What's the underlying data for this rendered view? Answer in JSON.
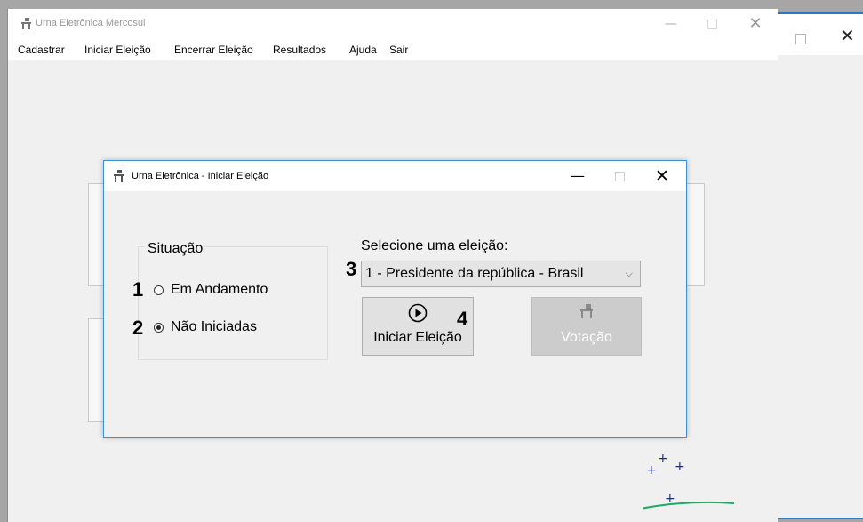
{
  "main_window": {
    "title": "Urna Eletrônica Mercosul",
    "controls": {
      "minimize": "—",
      "close": "✕"
    }
  },
  "menu": {
    "items": [
      "Cadastrar",
      "Iniciar Eleição",
      "Encerrar Eleição",
      "Resultados",
      "Ajuda",
      "Sair"
    ]
  },
  "background_window": {
    "close": "✕"
  },
  "dialog": {
    "title": "Urna Eletrônica - Iniciar Eleição",
    "controls": {
      "minimize": "—",
      "close": "✕"
    },
    "situacao": {
      "legend": "Situação",
      "options": [
        {
          "label": "Em Andamento",
          "checked": false
        },
        {
          "label": "Não Iniciadas",
          "checked": true
        }
      ]
    },
    "election_select": {
      "label": "Selecione uma eleição:",
      "selected": "1 - Presidente da república - Brasil"
    },
    "buttons": {
      "start": {
        "label": "Iniciar Eleição",
        "icon": "play-circle-icon",
        "enabled": true
      },
      "vote": {
        "label": "Votação",
        "icon": "ballot-box-icon",
        "enabled": false
      }
    },
    "annotations": [
      "1",
      "2",
      "3",
      "4"
    ]
  },
  "colors": {
    "accent_border": "#3f8fd8",
    "disabled_button": "#cccccc",
    "star_color": "#1e2a78",
    "arc_color": "#1ea86a"
  }
}
